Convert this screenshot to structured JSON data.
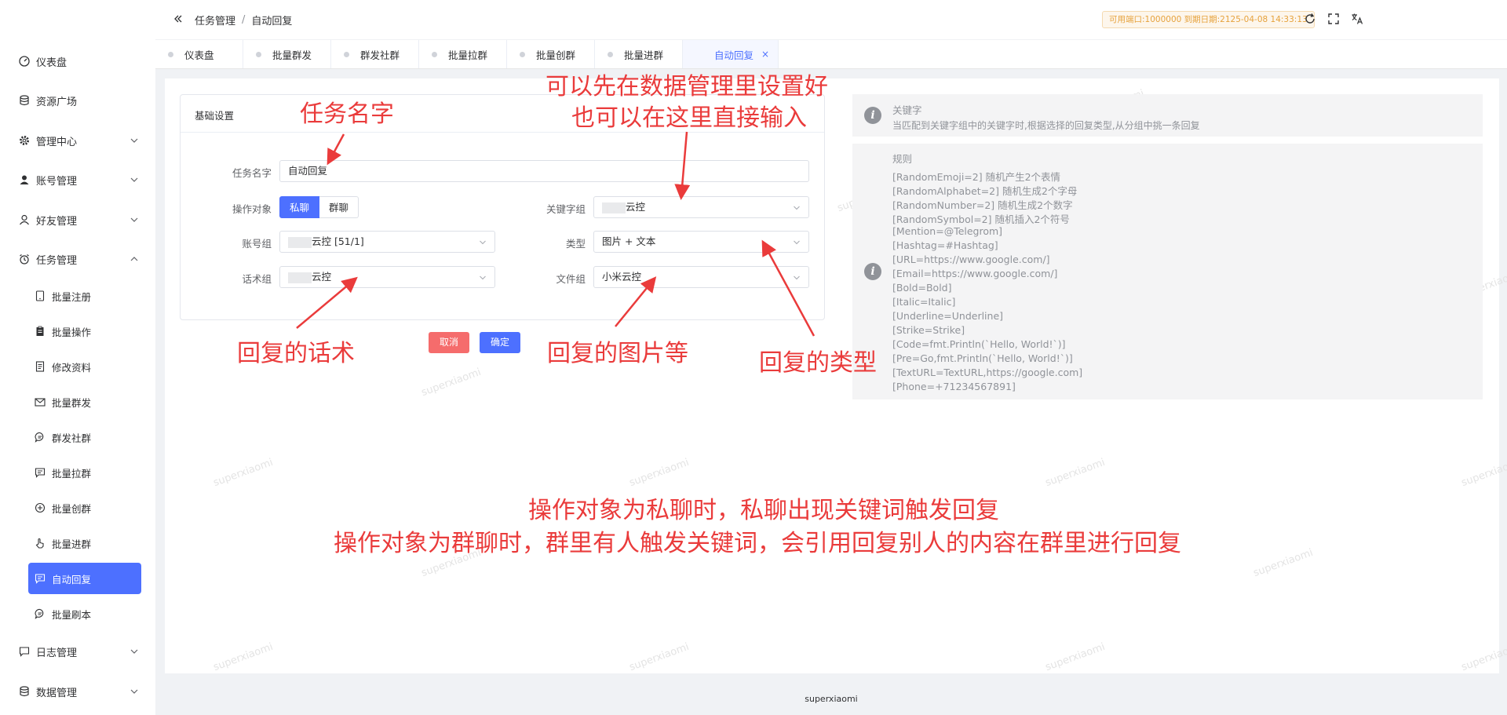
{
  "sidebar": {
    "items": [
      {
        "label": "仪表盘",
        "icon": "dashboard-icon"
      },
      {
        "label": "资源广场",
        "icon": "database-icon"
      },
      {
        "label": "管理中心",
        "icon": "gear-icon"
      },
      {
        "label": "账号管理",
        "icon": "user-filled-icon"
      },
      {
        "label": "好友管理",
        "icon": "user-icon"
      },
      {
        "label": "任务管理",
        "icon": "alarm-icon"
      }
    ],
    "sub_items": [
      {
        "label": "批量注册",
        "icon": "phone-icon"
      },
      {
        "label": "批量操作",
        "icon": "clipboard-icon"
      },
      {
        "label": "修改资料",
        "icon": "document-icon"
      },
      {
        "label": "批量群发",
        "icon": "mail-icon"
      },
      {
        "label": "群发社群",
        "icon": "chat-icon"
      },
      {
        "label": "批量拉群",
        "icon": "chat-square-icon"
      },
      {
        "label": "批量创群",
        "icon": "plus-circle-icon"
      },
      {
        "label": "批量进群",
        "icon": "pointer-icon"
      },
      {
        "label": "自动回复",
        "icon": "chat-square-icon"
      },
      {
        "label": "批量刷本",
        "icon": "chat-icon"
      }
    ],
    "bottom_items": [
      {
        "label": "日志管理",
        "icon": "chat-square-icon"
      },
      {
        "label": "数据管理",
        "icon": "database-icon"
      }
    ]
  },
  "header": {
    "crumb_parent": "任务管理",
    "crumb_sep": "/",
    "crumb_current": "自动回复",
    "badge": "可用端口:1000000 到期日期:2125-04-08 14:33:13"
  },
  "tabs": [
    {
      "label": "仪表盘"
    },
    {
      "label": "批量群发"
    },
    {
      "label": "群发社群"
    },
    {
      "label": "批量拉群"
    },
    {
      "label": "批量创群"
    },
    {
      "label": "批量进群"
    },
    {
      "label": "自动回复",
      "close": "×"
    }
  ],
  "form": {
    "card_title": "基础设置",
    "task_name_label": "任务名字",
    "task_name_value": "自动回复",
    "target_label": "操作对象",
    "target_private": "私聊",
    "target_group": "群聊",
    "keyword_group_label": "关键字组",
    "keyword_group_value": "云控",
    "account_group_label": "账号组",
    "account_group_value": "云控 [51/1]",
    "type_label": "类型",
    "type_value": "图片 + 文本",
    "script_group_label": "话术组",
    "script_group_value": "云控",
    "file_group_label": "文件组",
    "file_group_value": "小米云控",
    "cancel": "取消",
    "confirm": "确定"
  },
  "info": {
    "keyword_title": "关键字",
    "keyword_desc": "当匹配到关键字组中的关键字时,根据选择的回复类型,从分组中挑一条回复",
    "rules_title": "规则",
    "rules": [
      "[RandomEmoji=2] 随机产生2个表情",
      "[RandomAlphabet=2] 随机生成2个字母",
      "[RandomNumber=2] 随机生成2个数字",
      "[RandomSymbol=2] 随机插入2个符号",
      "[Mention=@Telegrom]",
      "[Hashtag=#Hashtag]",
      "[URL=https://www.google.com/]",
      "[Email=https://www.google.com/]",
      "[Bold=Bold]",
      "[Italic=Italic]",
      "[Underline=Underline]",
      "[Strike=Strike]",
      "[Code=fmt.Println(`Hello, World!`)]",
      "[Pre=Go,fmt.Println(`Hello, World!`)]",
      "[TextURL=TextURL,https://google.com]",
      "[Phone=+71234567891]"
    ]
  },
  "annotations": {
    "task_name": "任务名字",
    "keyword_line1": "可以先在数据管理里设置好",
    "keyword_line2": "也可以在这里直接输入",
    "script": "回复的话术",
    "file": "回复的图片等",
    "type": "回复的类型",
    "bottom_line1": "操作对象为私聊时，私聊出现关键词触发回复",
    "bottom_line2": "操作对象为群聊时，群里有人触发关键词，会引用回复别人的内容在群里进行回复"
  },
  "watermark": "superxiaomi",
  "footer": "superxiaomi",
  "colors": {
    "primary": "#4d70ff",
    "danger": "#f56c6c",
    "annotation": "#ea3b3b"
  }
}
